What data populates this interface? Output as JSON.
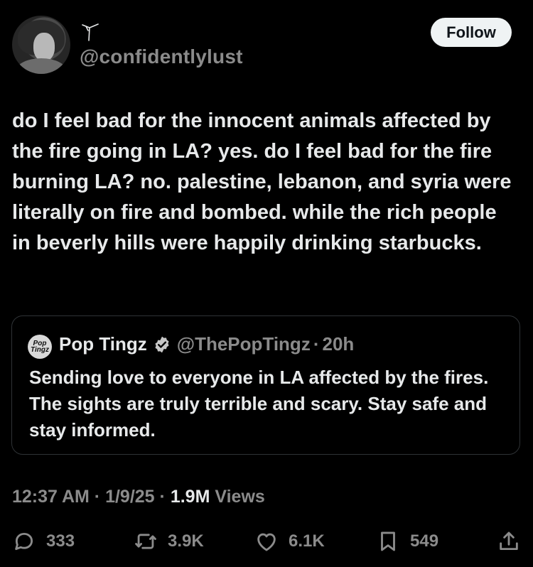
{
  "author": {
    "display_name": "",
    "handle": "@confidentlylust"
  },
  "follow_label": "Follow",
  "tweet": {
    "text": "do I feel bad for the innocent animals affected by the fire going in LA? yes. do I feel bad for the fire burning LA? no. palestine, lebanon, and syria were literally on fire and bombed. while the rich people in beverly hills were happily drinking starbucks."
  },
  "quote": {
    "avatar_text": "Pop Tingz",
    "name": "Pop Tingz",
    "handle": "@ThePopTingz",
    "separator": "·",
    "time": "20h",
    "text": "Sending love to everyone in LA affected by the fires. The sights are truly terrible and scary. Stay safe and stay informed."
  },
  "meta": {
    "time": "12:37 AM",
    "sep1": "·",
    "date": "1/9/25",
    "sep2": "·",
    "views_count": "1.9M",
    "views_label": "Views"
  },
  "actions": {
    "replies": "333",
    "reposts": "3.9K",
    "likes": "6.1K",
    "bookmarks": "549"
  },
  "icons": {
    "verified": "verified-badge-icon",
    "reply": "reply-icon",
    "repost": "repost-icon",
    "like": "heart-icon",
    "bookmark": "bookmark-icon",
    "share": "share-icon"
  }
}
